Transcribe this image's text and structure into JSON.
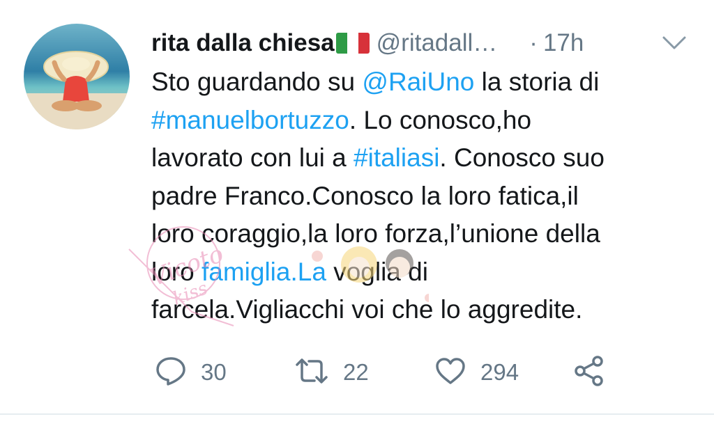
{
  "tweet": {
    "display_name": "rita dalla chiesa",
    "flag_icon": "italian-flag-icon",
    "handle": "@ritadall…",
    "separator": "·",
    "time": "17h",
    "menu_icon": "chevron-down-icon",
    "avatar": "avatar-woman-sun-hat-beach",
    "lines": [
      [
        {
          "t": "Sto guardando su "
        },
        {
          "t": "@RaiUno",
          "link": true
        },
        {
          "t": " la storia di"
        }
      ],
      [
        {
          "t": "#manuelbortuzzo",
          "link": true
        },
        {
          "t": ". Lo conosco,ho"
        }
      ],
      [
        {
          "t": "lavorato con lui a "
        },
        {
          "t": "#italiasi",
          "link": true
        },
        {
          "t": ". Conosco suo"
        }
      ],
      [
        {
          "t": "padre Franco.Conosco la loro fatica,il"
        }
      ],
      [
        {
          "t": "loro coraggio,la loro forza,l’unione della"
        }
      ],
      [
        {
          "t": "loro "
        },
        {
          "t": "famiglia.La",
          "link": true
        },
        {
          "t": " voglia di"
        }
      ],
      [
        {
          "t": "farcela.Vigliacchi voi che lo aggredite."
        }
      ]
    ],
    "watermark": "Vicoto kiss"
  },
  "actions": {
    "reply": {
      "icon": "reply-icon",
      "count": "30"
    },
    "retweet": {
      "icon": "retweet-icon",
      "count": "22"
    },
    "like": {
      "icon": "heart-icon",
      "count": "294"
    },
    "share": {
      "icon": "share-icon"
    }
  },
  "colors": {
    "link": "#1da1f2",
    "muted": "#657786",
    "text": "#14171a",
    "divider": "#e6ecf0"
  }
}
